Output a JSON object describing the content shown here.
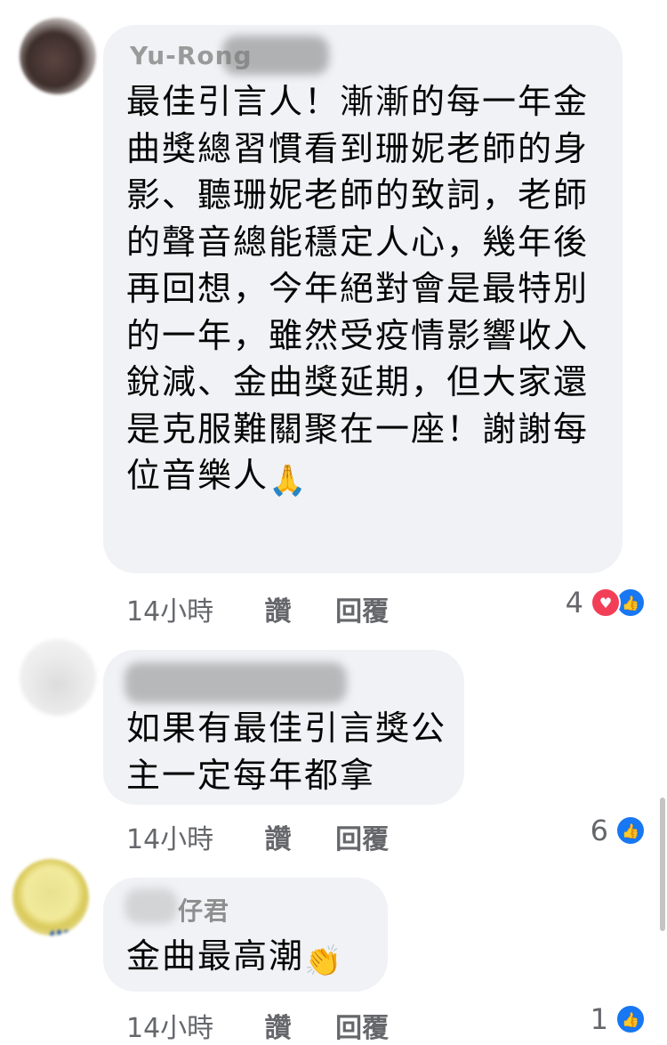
{
  "comments": [
    {
      "author": "Yu-Rong",
      "text": "最佳引言人！漸漸的每一年金曲獎總習慣看到珊妮老師的身影、聽珊妮老師的致詞，老師的聲音總能穩定人心，幾年後再回想，今年絕對會是最特別的一年，雖然受疫情影響收入銳減、金曲獎延期，但大家還是克服難關聚在一座！謝謝每位音樂人",
      "emoji": "🙏",
      "time": "14小時",
      "like_label": "讚",
      "reply_label": "回覆",
      "reaction_count": "4",
      "reactions": [
        "heart-icon",
        "thumbs-up-icon"
      ]
    },
    {
      "author": "",
      "text": "如果有最佳引言獎公主一定每年都拿",
      "emoji": "",
      "time": "14小時",
      "like_label": "讚",
      "reply_label": "回覆",
      "reaction_count": "6",
      "reactions": [
        "thumbs-up-icon"
      ]
    },
    {
      "author": "仔君",
      "text": "金曲最高潮",
      "emoji": "👏",
      "time": "14小時",
      "like_label": "讚",
      "reply_label": "回覆",
      "reaction_count": "1",
      "reactions": [
        "thumbs-up-icon"
      ]
    }
  ],
  "colors": {
    "bubble": "#f0f2f5",
    "meta_text": "#65676b",
    "like_blue": "#1877f2",
    "love_red": "#f33e58"
  }
}
